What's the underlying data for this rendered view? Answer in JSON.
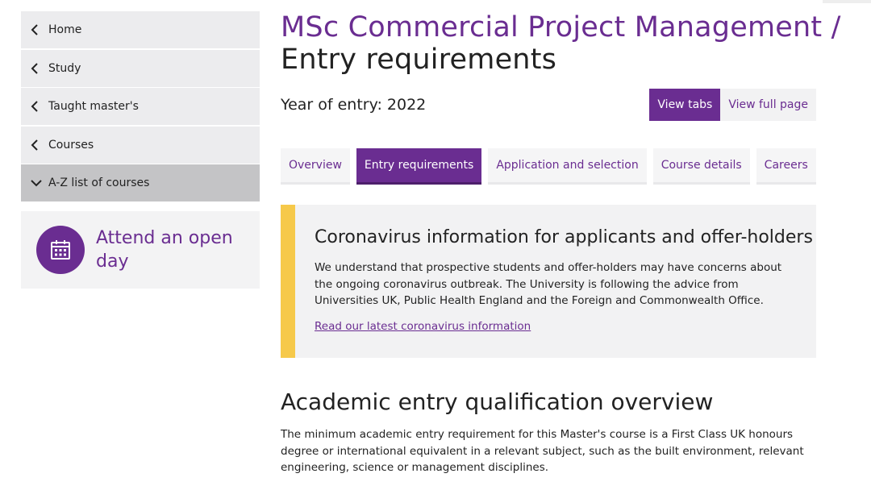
{
  "sidebar": {
    "items": [
      {
        "label": "Home",
        "icon": "chevron-left-icon"
      },
      {
        "label": "Study",
        "icon": "chevron-left-icon"
      },
      {
        "label": "Taught master's",
        "icon": "chevron-left-icon"
      },
      {
        "label": "Courses",
        "icon": "chevron-left-icon"
      },
      {
        "label": "A-Z list of courses",
        "icon": "chevron-down-icon",
        "active": true
      }
    ],
    "open_day": {
      "label": "Attend an open day",
      "icon": "calendar-icon"
    }
  },
  "header": {
    "course": "MSc Commercial Project Management /",
    "section": "Entry requirements",
    "year_of_entry": "Year of entry: 2022"
  },
  "view_toggle": {
    "tabs_label": "View tabs",
    "full_page_label": "View full page"
  },
  "tabs": [
    {
      "label": "Overview"
    },
    {
      "label": "Entry requirements",
      "active": true
    },
    {
      "label": "Application and selection"
    },
    {
      "label": "Course details"
    },
    {
      "label": "Careers"
    }
  ],
  "notice": {
    "title": "Coronavirus information for applicants and offer-holders",
    "body": "We understand that prospective students and offer-holders may have concerns about the ongoing coronavirus outbreak. The University is following the advice from Universities UK, Public Health England and the Foreign and Commonwealth Office.",
    "link": "Read our latest coronavirus information"
  },
  "academic": {
    "heading": "Academic entry qualification overview",
    "body": "The minimum academic entry requirement for this Master's course is a First Class UK honours degree or international equivalent in a relevant subject, such as the built environment, relevant engineering, science or management disciplines."
  },
  "colors": {
    "brand": "#6a2d91",
    "notice_accent": "#f6c94a"
  }
}
